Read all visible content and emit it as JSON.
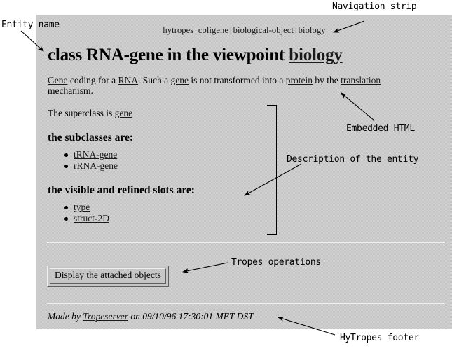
{
  "navigation": {
    "items": [
      {
        "label": "hytropes"
      },
      {
        "label": "coligene"
      },
      {
        "label": "biological-object"
      },
      {
        "label": "biology"
      }
    ],
    "separator": "|"
  },
  "title": {
    "prefix": "class RNA-gene in the viewpoint ",
    "viewpoint_link": "biology"
  },
  "description": {
    "part1": "Gene",
    "part2": " coding for a ",
    "part3": "RNA",
    "part4": ". Such a ",
    "part5": "gene",
    "part6": " is not transformed into a ",
    "part7": "protein",
    "part8": " by the ",
    "part9": "translation",
    "part10": " mechanism."
  },
  "superclass": {
    "label": "The superclass is ",
    "link": "gene"
  },
  "subclasses": {
    "heading": "the subclasses are:",
    "items": [
      {
        "label": "tRNA-gene"
      },
      {
        "label": "rRNA-gene"
      }
    ]
  },
  "slots": {
    "heading": "the visible and refined slots are:",
    "items": [
      {
        "label": "type"
      },
      {
        "label": "struct-2D"
      }
    ]
  },
  "operations": {
    "display_button": "Display the attached objects"
  },
  "footer": {
    "prefix": "Made by ",
    "link": "Tropeserver",
    "suffix": " on 09/10/96 17:30:01 MET DST"
  },
  "annotations": {
    "entity_name": "Entity name",
    "navigation_strip": "Navigation strip",
    "embedded_html": "Embedded HTML",
    "description_of_entity": "Description of the entity",
    "tropes_operations": "Tropes operations",
    "hytropes_footer": "HyTropes footer"
  },
  "colors": {
    "page_background": "#c6c6c6",
    "canvas_background": "#ffffff",
    "text": "#000000",
    "link": "#1a1a1a"
  }
}
